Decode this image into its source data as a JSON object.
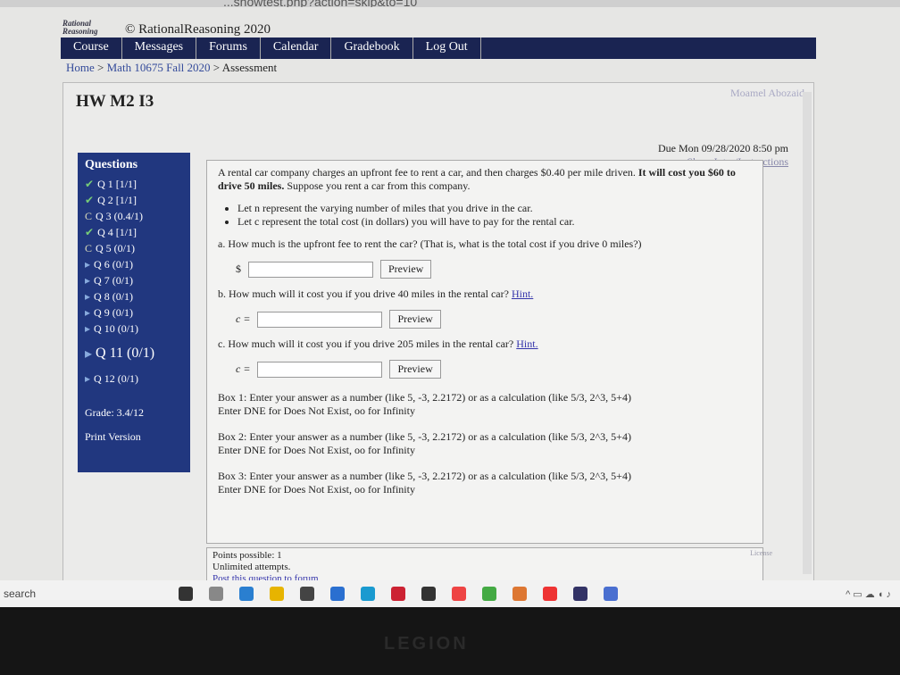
{
  "browser": {
    "url": "...showtest.php?action=skip&to=10"
  },
  "header": {
    "logo": "Rational Reasoning",
    "copyright": "© RationalReasoning 2020"
  },
  "nav": [
    "Course",
    "Messages",
    "Forums",
    "Calendar",
    "Gradebook",
    "Log Out"
  ],
  "breadcrumb": {
    "home": "Home",
    "course": "Math 10675 Fall 2020",
    "current": "Assessment",
    "sep": ">"
  },
  "user": "Moamel Abozaid",
  "title": "HW M2 I3",
  "due": {
    "text": "Due Mon 09/28/2020 8:50 pm",
    "link": "Show Intro/Instructions"
  },
  "sidebar": {
    "heading": "Questions",
    "items": [
      {
        "icon": "check",
        "label": "Q 1 [1/1]"
      },
      {
        "icon": "check",
        "label": "Q 2 [1/1]"
      },
      {
        "icon": "partial",
        "label": "Q 3 (0.4/1)"
      },
      {
        "icon": "check",
        "label": "Q 4 [1/1]"
      },
      {
        "icon": "partial",
        "label": "Q 5 (0/1)"
      },
      {
        "icon": "arrow",
        "label": "Q 6 (0/1)"
      },
      {
        "icon": "arrow",
        "label": "Q 7 (0/1)"
      },
      {
        "icon": "arrow",
        "label": "Q 8 (0/1)"
      },
      {
        "icon": "arrow",
        "label": "Q 9 (0/1)"
      },
      {
        "icon": "arrow",
        "label": "Q 10 (0/1)"
      },
      {
        "icon": "arrow",
        "label": "Q 11 (0/1)"
      },
      {
        "icon": "arrow",
        "label": "Q 12 (0/1)"
      }
    ],
    "grade": "Grade: 3.4/12",
    "print": "Print Version"
  },
  "question": {
    "intro": "A rental car company charges an upfront fee to rent a car, and then charges $0.40 per mile driven.",
    "bold": "It will cost you $60 to drive 50 miles.",
    "intro2": " Suppose you rent a car from this company.",
    "bullets": [
      "Let n represent the varying number of miles that you drive in the car.",
      "Let c represent the total cost (in dollars) you will have to pay for the rental car."
    ],
    "a": "a. How much is the upfront fee to rent the car? (That is, what is the total cost if you drive 0 miles?)",
    "a_prefix": "$",
    "b": "b. How much will it cost you if you drive 40 miles in the rental car?",
    "c": "c. How much will it cost you if you drive 205 miles in the rental car?",
    "hint": "Hint.",
    "eq": "c =",
    "preview": "Preview",
    "boxes": [
      {
        "l1": "Box 1: Enter your answer as a number (like 5, -3, 2.2172) or as a calculation (like 5/3, 2^3, 5+4)",
        "l2": "Enter DNE for Does Not Exist, oo for Infinity"
      },
      {
        "l1": "Box 2: Enter your answer as a number (like 5, -3, 2.2172) or as a calculation (like 5/3, 2^3, 5+4)",
        "l2": "Enter DNE for Does Not Exist, oo for Infinity"
      },
      {
        "l1": "Box 3: Enter your answer as a number (like 5, -3, 2.2172) or as a calculation (like 5/3, 2^3, 5+4)",
        "l2": "Enter DNE for Does Not Exist, oo for Infinity"
      }
    ]
  },
  "footer": {
    "points": "Points possible: 1",
    "attempts": "Unlimited attempts.",
    "forum": "Post this question to forum",
    "license": "License"
  },
  "taskbar": {
    "search": "search",
    "brand": "LEGION"
  }
}
